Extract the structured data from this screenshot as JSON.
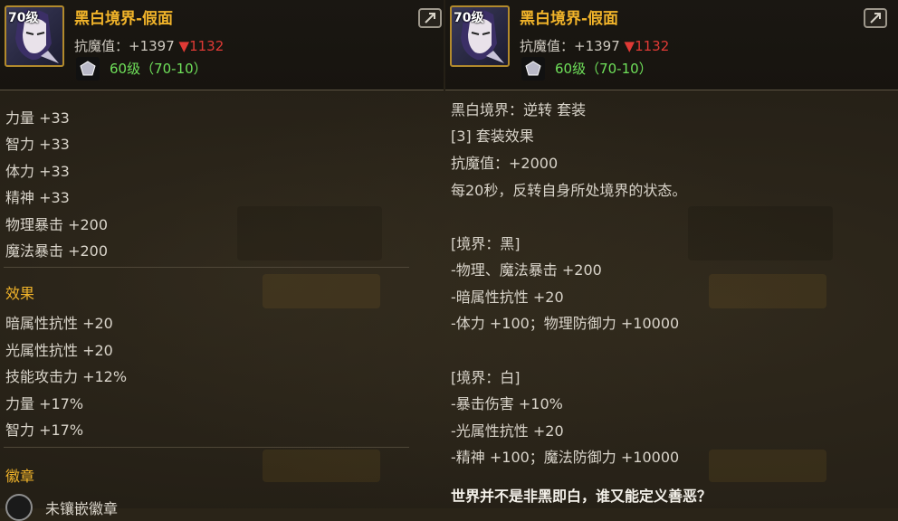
{
  "item": {
    "level_badge": "70级",
    "title": "黑白境界-假面",
    "resist_label": "抗魔值：",
    "resist_value": "+1397",
    "resist_diff": "▼1132",
    "gem_text": "60级（70-10）"
  },
  "left_stats": [
    "力量 +33",
    "智力 +33",
    "体力 +33",
    "精神 +33",
    "物理暴击 +200",
    "魔法暴击 +200"
  ],
  "effects": {
    "title": "效果",
    "lines": [
      "暗属性抗性 +20",
      "光属性抗性 +20",
      "技能攻击力 +12%",
      "力量 +17%",
      "智力 +17%"
    ]
  },
  "emblem": {
    "title": "徽章",
    "empty_text": "未镶嵌徽章"
  },
  "set_info": {
    "name": "黑白境界：逆转 套装",
    "bonus_title": "[3] 套装效果",
    "bonus_resist": "抗魔值：+2000",
    "bonus_desc": "每20秒，反转自身所处境界的状态。",
    "black": {
      "title": "[境界：黑]",
      "lines": [
        "-物理、魔法暴击 +200",
        "-暗属性抗性 +20",
        "-体力 +100；物理防御力 +10000"
      ]
    },
    "white": {
      "title": "[境界：白]",
      "lines": [
        "-暴击伤害 +10%",
        "-光属性抗性 +20",
        "-精神 +100；魔法防御力 +10000"
      ]
    },
    "quote": "世界并不是非黑即白，谁又能定义善恶？"
  },
  "colors": {
    "title": "#f0b32a",
    "gem": "#6fe05a",
    "down": "#e03a35"
  },
  "icons": [
    "mask-icon",
    "gem-icon",
    "share-icon",
    "emblem-slot-icon"
  ]
}
